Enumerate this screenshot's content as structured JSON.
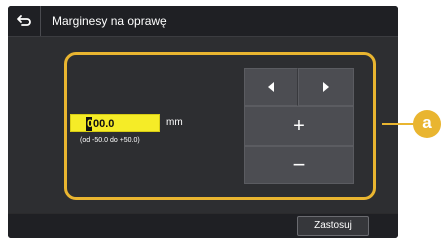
{
  "header": {
    "title": "Marginesy na oprawę",
    "back_icon": "back-arrow-icon"
  },
  "value_field": {
    "cursor_char": "0",
    "value": "00.0",
    "unit": "mm",
    "range": "(od -50.0 do +50.0)"
  },
  "buttons": {
    "left_icon": "triangle-left-icon",
    "right_icon": "triangle-right-icon",
    "plus": "+",
    "minus": "−"
  },
  "footer": {
    "apply_label": "Zastosuj"
  },
  "callout": {
    "label": "a"
  },
  "colors": {
    "accent": "#e9b530",
    "field": "#f5ec27",
    "background": "#2b2b2d"
  }
}
